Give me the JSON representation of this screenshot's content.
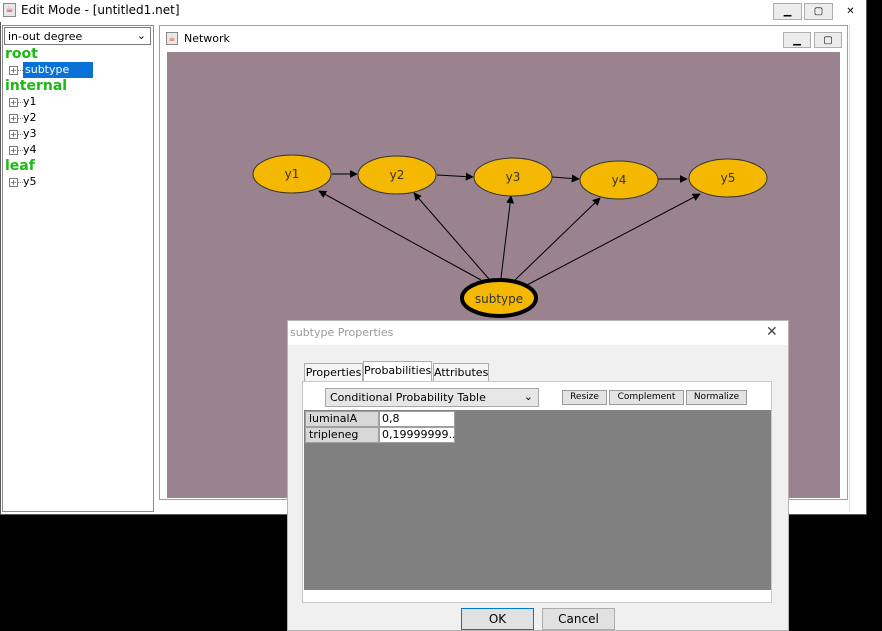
{
  "window": {
    "title": "Edit Mode - [untitled1.net]",
    "app_icon": "java-cup-icon",
    "controls": {
      "minimize": "minimize-icon",
      "maximize": "maximize-icon",
      "close": "close-icon"
    }
  },
  "left_panel": {
    "layout_select": {
      "value": "in-out degree"
    },
    "groups": [
      {
        "label": "root",
        "items": [
          "subtype"
        ]
      },
      {
        "label": "internal",
        "items": [
          "y1",
          "y2",
          "y3",
          "y4"
        ]
      },
      {
        "label": "leaf",
        "items": [
          "y5"
        ]
      }
    ],
    "selected_item": "subtype"
  },
  "network": {
    "title": "Network",
    "canvas_color": "#9a828f",
    "node_color": "#f5b800",
    "nodes": [
      "y1",
      "y2",
      "y3",
      "y4",
      "y5",
      "subtype"
    ]
  },
  "dialog": {
    "title": "subtype Properties",
    "tabs": [
      "Properties",
      "Probabilities",
      "Attributes"
    ],
    "active_tab": "Probabilities",
    "table_select": {
      "value": "Conditional Probability Table"
    },
    "buttons": {
      "resize": "Resize",
      "complement": "Complement",
      "normalize": "Normalize"
    },
    "rows": [
      {
        "label": "luminalA",
        "value": "0,8"
      },
      {
        "label": "tripleneg",
        "value": "0,19999999..."
      }
    ],
    "ok": "OK",
    "cancel": "Cancel"
  }
}
